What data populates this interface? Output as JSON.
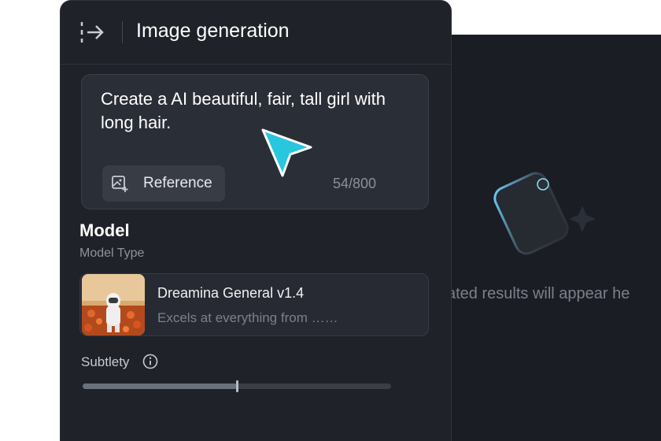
{
  "header": {
    "title": "Image generation",
    "collapse_icon": "collapse-panel-icon"
  },
  "prompt": {
    "text": "Create a AI beautiful, fair, tall girl with long hair.",
    "reference_label": "Reference",
    "counter": "54/800"
  },
  "model": {
    "section_title": "Model",
    "section_subtitle": "Model Type",
    "name": "Dreamina General v1.4",
    "description": "Excels at everything from ……"
  },
  "subtlety": {
    "label": "Subtlety",
    "value_fraction": 0.5
  },
  "results": {
    "placeholder": "ated results will appear he"
  },
  "colors": {
    "panel_bg": "#1f2229",
    "cursor_accent": "#29c6e0",
    "results_bg": "#1a1d24"
  }
}
